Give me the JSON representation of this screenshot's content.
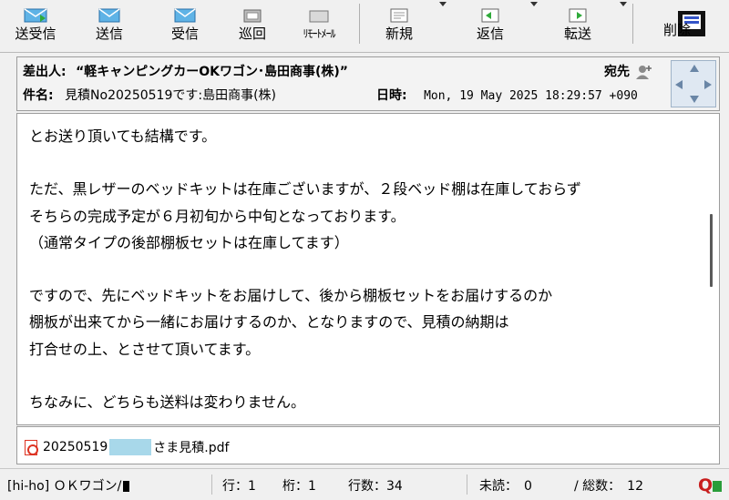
{
  "toolbar": {
    "buttons": [
      {
        "label": "送受信",
        "icon": "send-receive-icon"
      },
      {
        "label": "送信",
        "icon": "send-icon"
      },
      {
        "label": "受信",
        "icon": "receive-icon"
      },
      {
        "label": "巡回",
        "icon": "patrol-icon"
      },
      {
        "label": "ﾘﾓｰﾄﾒｰﾙ",
        "icon": "remote-mail-icon"
      },
      {
        "label": "新規",
        "icon": "new-mail-icon"
      },
      {
        "label": "返信",
        "icon": "reply-icon"
      },
      {
        "label": "転送",
        "icon": "forward-icon"
      },
      {
        "label": "削除",
        "icon": "delete-icon"
      }
    ]
  },
  "header": {
    "from_label": "差出人:",
    "from_value": "“軽キャンピングカーOKワゴン･島田商事(株)”",
    "to_label": "宛先",
    "subject_label": "件名:",
    "subject_value": "見積No20250519です:島田商事(株)",
    "date_label": "日時:",
    "date_value": "Mon, 19 May 2025 18:29:57 +090"
  },
  "body": {
    "text": "とお送り頂いても結構です。\n\nただ、黒レザーのベッドキットは在庫ございますが、２段ベッド棚は在庫しておらず\nそちらの完成予定が６月初旬から中旬となっております。\n（通常タイプの後部棚板セットは在庫してます）\n\nですので、先にベッドキットをお届けして、後から棚板セットをお届けするのか\n棚板が出来てから一緒にお届けするのか、となりますので、見積の納期は\n打合せの上、とさせて頂いてます。\n\nちなみに、どちらも送料は変わりません。"
  },
  "attachment": {
    "name_prefix": "20250519",
    "name_suffix": "さま見積.pdf"
  },
  "status": {
    "account": "[hi-ho] ＯＫワゴン/",
    "line": "行：1",
    "col": "桁：1",
    "line_count": "行数：34",
    "unread": "未読：　0",
    "total": "/ 総数：　12"
  },
  "colors": {
    "redaction": "#a8d8ea",
    "pdf_red": "#d32222",
    "nav_pad": "#dfe8f2"
  }
}
